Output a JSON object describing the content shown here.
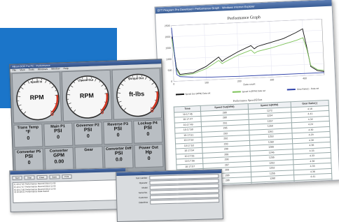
{
  "colors": {
    "blue_block": "#1b75c9",
    "series_black": "#111111",
    "series_green": "#7ec35a",
    "series_blue": "#2c3fa8",
    "gauge_redline": "#d0321e"
  },
  "graph_window": {
    "title_text": "EFT Program Pro Download / Performance Graph - Windows Internet Explorer",
    "graph_title": "Performance Graph",
    "xlabel": "Data count",
    "legend": [
      "Speed Out (RPM) Data set",
      "Speed In (RPM) Data set",
      "Gear Ratio(:) - Data set"
    ],
    "table_title": "Performance Speed/Effort",
    "table_headers": [
      "Time",
      "Speed Out(RPM)",
      "Speed In(RPM)",
      "Gear Ratio(:)"
    ],
    "table_rows": [
      [
        "10:17:45",
        "288",
        "1272",
        "4.16"
      ],
      [
        "10:17:47",
        "280",
        "1234",
        "4.41"
      ],
      [
        "10:17:49",
        "291",
        "1257",
        "4.32"
      ],
      [
        "10:17:50",
        "295",
        "1250",
        "4.24"
      ],
      [
        "10:17:51",
        "293",
        "1261",
        "4.30"
      ],
      [
        "10:17:52",
        "292",
        "1253",
        "4.29"
      ],
      [
        "10:17:53",
        "293",
        "1260",
        "4.30"
      ],
      [
        "10:17:54",
        "290",
        "1265",
        "4.36"
      ],
      [
        "10:17:55",
        "288",
        "1246",
        "4.33"
      ],
      [
        "10:17:56",
        "290",
        "1255",
        "4.33"
      ],
      [
        "10:17:57",
        "287",
        "1252",
        "4.36"
      ],
      [
        "10:17:58",
        "289",
        "1252",
        "4.33"
      ],
      [
        "10:17:59",
        "288",
        "1255",
        "4.36"
      ],
      [
        "10:18:00",
        "286",
        "1260",
        "4.41"
      ],
      [
        "10:18:01",
        "288",
        "1258",
        "4.37"
      ]
    ]
  },
  "chart_data": {
    "type": "line",
    "title": "Performance Graph",
    "xlabel": "Data count",
    "ylabel": "",
    "xlim": [
      0,
      460
    ],
    "ylim": [
      0,
      2500
    ],
    "x_ticks": [
      "0",
      "100",
      "200",
      "300",
      "400"
    ],
    "y_ticks": [
      "0",
      "500",
      "1000",
      "1500",
      "2000",
      "2500"
    ],
    "grid": true,
    "legend_position": "bottom",
    "series": [
      {
        "name": "Speed Out (RPM) Data set",
        "color": "#111111",
        "x": [
          0,
          10,
          20,
          60,
          100,
          140,
          150,
          160,
          200,
          240,
          250,
          260,
          300,
          340,
          380,
          400,
          410,
          420,
          440,
          460
        ],
        "y": [
          2000,
          600,
          300,
          350,
          600,
          1000,
          800,
          900,
          1200,
          1450,
          1300,
          1400,
          1550,
          1700,
          1950,
          2100,
          1300,
          400,
          200,
          150
        ]
      },
      {
        "name": "Speed In (RPM) Data set",
        "color": "#7ec35a",
        "x": [
          0,
          10,
          20,
          60,
          100,
          140,
          150,
          160,
          200,
          240,
          250,
          260,
          300,
          340,
          380,
          400,
          410,
          420,
          440,
          460
        ],
        "y": [
          1900,
          500,
          250,
          300,
          500,
          850,
          700,
          780,
          1050,
          1250,
          1100,
          1180,
          1300,
          1450,
          1600,
          1700,
          1200,
          450,
          250,
          200
        ]
      },
      {
        "name": "Gear Ratio(:) - Data set",
        "color": "#2c3fa8",
        "x": [
          0,
          10,
          20,
          60,
          100,
          150,
          200,
          300,
          400,
          440,
          460
        ],
        "y": [
          2400,
          300,
          200,
          150,
          120,
          110,
          100,
          100,
          100,
          100,
          100
        ]
      }
    ]
  },
  "main_window": {
    "title_text": "Allison DOC For PC - Performance",
    "menu": [
      "File",
      "View",
      "Tools",
      "Windows",
      "Window",
      "Help"
    ],
    "gauges": [
      {
        "label": "Speed In",
        "unit": "RPM",
        "value": "0"
      },
      {
        "label": "Speed Out",
        "unit": "RPM",
        "value": "0"
      },
      {
        "label": "Torque Out",
        "unit": "ft-lbs",
        "value": "0"
      }
    ],
    "cells": [
      {
        "label": "Trans Temp",
        "unit": "°F",
        "value": "0"
      },
      {
        "label": "Main P1",
        "unit": "PSI",
        "value": "0"
      },
      {
        "label": "Governor P2",
        "unit": "PSI",
        "value": "0"
      },
      {
        "label": "Reverse P3",
        "unit": "PSI",
        "value": "0"
      },
      {
        "label": "Lockup P4",
        "unit": "PSI",
        "value": "0"
      },
      {
        "label": "Converter P5",
        "unit": "PSI",
        "value": "0"
      },
      {
        "label": "Converter",
        "unit": "GPM",
        "value": "0.00"
      },
      {
        "label": "Gear",
        "unit": "",
        "value": ""
      },
      {
        "label": "Converter Diff",
        "unit": "PSI",
        "value": "0.0"
      },
      {
        "label": "Power Out",
        "unit": "Hp",
        "value": "0"
      }
    ]
  },
  "log_window": {
    "tools": [
      "Start",
      "Stop",
      "Clear",
      "Save",
      "Print"
    ],
    "lines": [
      "1) 10:17:45 Performance Record 2014-11-05",
      "2) 10:17:47 Performance Record 2014-11-05",
      "3) 10:17:49 Performance Record 2014-11-05",
      "4) 10:18:01 Performance Data Saved"
    ]
  },
  "form_window": {
    "fields": [
      "Test number",
      "Operator",
      "Model",
      "Serial No.",
      "Customer",
      "Date/time"
    ]
  }
}
